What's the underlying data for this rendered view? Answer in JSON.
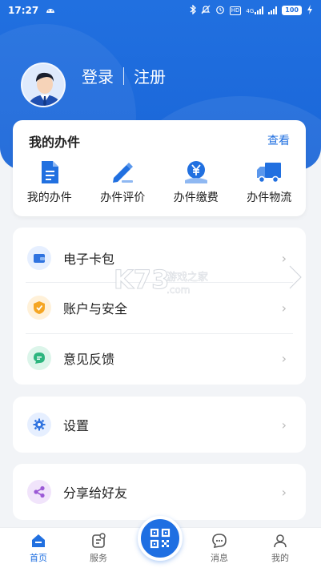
{
  "status": {
    "time": "17:27",
    "battery": "100",
    "network": "4G"
  },
  "profile": {
    "login": "登录",
    "register": "注册"
  },
  "affairs": {
    "title": "我的办件",
    "more": "查看",
    "items": [
      {
        "label": "我的办件",
        "icon": "document-icon"
      },
      {
        "label": "办件评价",
        "icon": "pen-icon"
      },
      {
        "label": "办件缴费",
        "icon": "yuan-icon"
      },
      {
        "label": "办件物流",
        "icon": "truck-icon"
      }
    ]
  },
  "menu": {
    "group1": [
      {
        "label": "电子卡包",
        "icon": "wallet-icon",
        "color": "#2f73e0"
      },
      {
        "label": "账户与安全",
        "icon": "shield-icon",
        "color": "#f5a623"
      },
      {
        "label": "意见反馈",
        "icon": "chat-icon",
        "color": "#2cb57e"
      }
    ],
    "group2": [
      {
        "label": "设置",
        "icon": "gear-icon",
        "color": "#2f73e0"
      }
    ],
    "group3": [
      {
        "label": "分享给好友",
        "icon": "share-icon",
        "color": "#9b59d6"
      }
    ]
  },
  "tabs": [
    {
      "label": "首页",
      "icon": "home-icon",
      "active": true
    },
    {
      "label": "服务",
      "icon": "service-icon",
      "active": false
    },
    {
      "label": "消息",
      "icon": "message-icon",
      "active": false
    },
    {
      "label": "我的",
      "icon": "user-icon",
      "active": false
    }
  ],
  "watermark": {
    "brand": "K73",
    "text": "游戏之家",
    "domain": ".com"
  },
  "colors": {
    "primary": "#2170e0",
    "background": "#f2f4f7"
  }
}
